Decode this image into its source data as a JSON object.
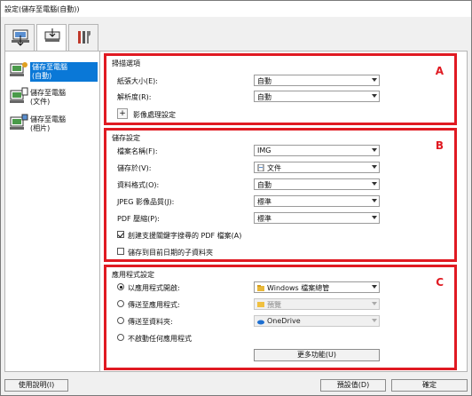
{
  "window": {
    "title": "設定(儲存至電腦(自動))"
  },
  "tabs": [
    {
      "name": "scan-from-computer",
      "icon": "computer-scan-icon"
    },
    {
      "name": "scan-from-panel",
      "icon": "scanner-panel-icon"
    },
    {
      "name": "general-settings",
      "icon": "tools-icon"
    }
  ],
  "sidebar": {
    "items": [
      {
        "label": "儲存至電腦\n(自動)",
        "icon": "computer-auto-icon",
        "active": true
      },
      {
        "label": "儲存至電腦\n(文件)",
        "icon": "computer-document-icon",
        "active": false
      },
      {
        "label": "儲存至電腦\n(相片)",
        "icon": "computer-photo-icon",
        "active": false
      }
    ]
  },
  "scan_options": {
    "header": "掃描選項",
    "letter": "A",
    "paper_size_label": "紙張大小(E):",
    "paper_size_value": "自動",
    "resolution_label": "解析度(R):",
    "resolution_value": "自動",
    "image_processing_label": "影像處理設定",
    "image_processing_toggle": "+"
  },
  "save_settings": {
    "header": "儲存設定",
    "letter": "B",
    "file_name_label": "檔案名稱(F):",
    "file_name_value": "IMG",
    "save_in_label": "儲存於(V):",
    "save_in_value": "文件",
    "data_format_label": "資料格式(O):",
    "data_format_value": "自動",
    "jpeg_quality_label": "JPEG 影像品質(J):",
    "jpeg_quality_value": "標準",
    "pdf_compression_label": "PDF 壓縮(P):",
    "pdf_compression_value": "標準",
    "keyword_pdf_label": "創建支援關鍵字搜尋的 PDF 檔案(A)",
    "keyword_pdf_checked": true,
    "subfolder_label": "儲存到目前日期的子資料夾",
    "subfolder_checked": false
  },
  "app_settings": {
    "header": "應用程式設定",
    "letter": "C",
    "open_with_label": "以應用程式開啟:",
    "open_with_value": "Windows 檔案總管",
    "send_to_app_label": "傳送至應用程式:",
    "send_to_app_value": "預覽",
    "send_to_folder_label": "傳送至資料夾:",
    "send_to_folder_value": "OneDrive",
    "no_app_label": "不啟動任何應用程式",
    "more_functions_label": "更多功能(U)",
    "selected_option": "open_with"
  },
  "footer": {
    "help_label": "使用說明(I)",
    "defaults_label": "預設值(D)",
    "ok_label": "確定"
  },
  "colors": {
    "highlight_border": "#e01a22",
    "selection": "#0a78d7"
  }
}
